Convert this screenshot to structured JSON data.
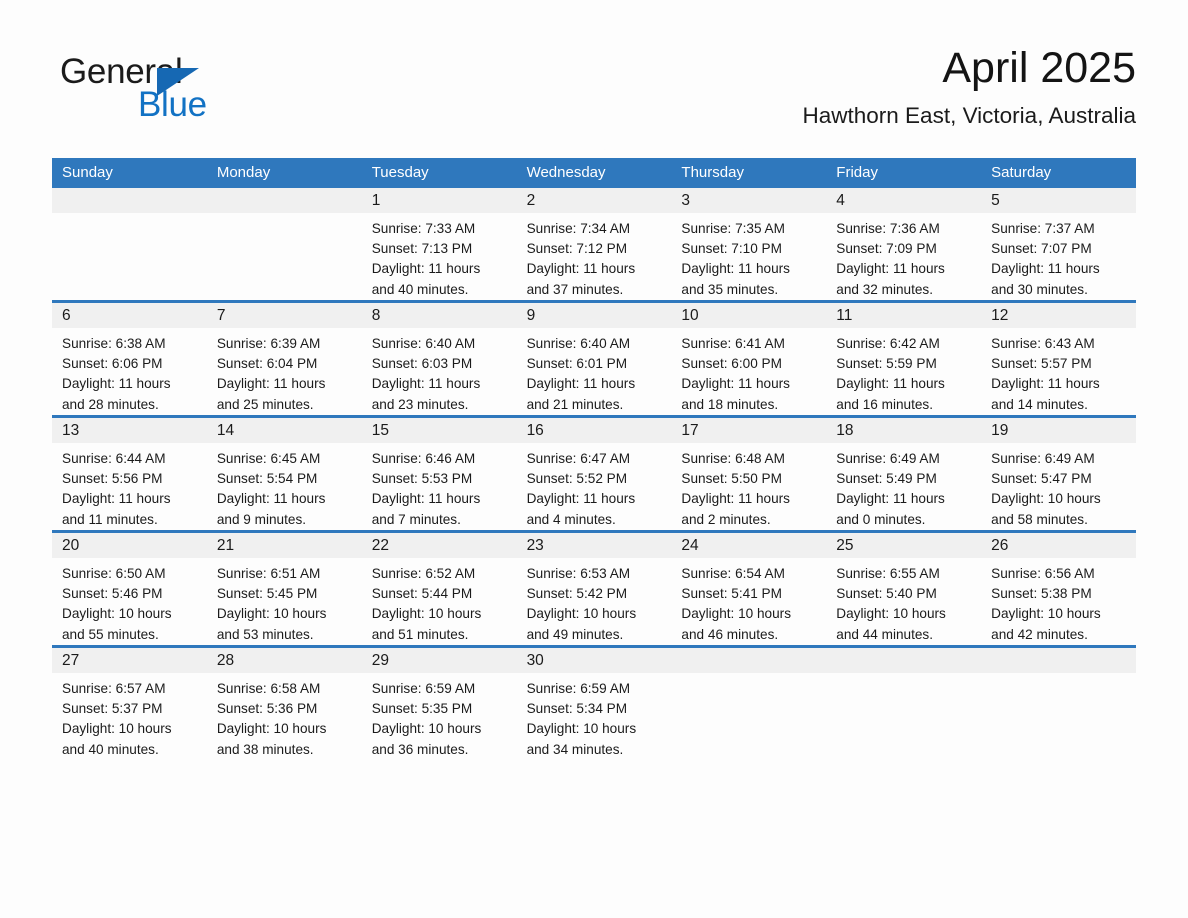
{
  "logo": {
    "word_one": "General",
    "word_two": "Blue",
    "triangle_color": "#1668b3",
    "blue_color": "#1272c4"
  },
  "header": {
    "month_title": "April 2025",
    "location": "Hawthorn East, Victoria, Australia"
  },
  "theme": {
    "header_blue": "#2f78bd",
    "day_band_gray": "#f0f0f0",
    "page_background": "#fdfdfd",
    "text_color": "#1b1b1b"
  },
  "weekdays": [
    "Sunday",
    "Monday",
    "Tuesday",
    "Wednesday",
    "Thursday",
    "Friday",
    "Saturday"
  ],
  "weeks": [
    [
      {
        "day": "",
        "empty": true,
        "sunrise": "",
        "sunset": "",
        "daylight_line1": "",
        "daylight_line2": ""
      },
      {
        "day": "",
        "empty": true,
        "sunrise": "",
        "sunset": "",
        "daylight_line1": "",
        "daylight_line2": ""
      },
      {
        "day": "1",
        "empty": false,
        "sunrise": "Sunrise: 7:33 AM",
        "sunset": "Sunset: 7:13 PM",
        "daylight_line1": "Daylight: 11 hours",
        "daylight_line2": "and 40 minutes."
      },
      {
        "day": "2",
        "empty": false,
        "sunrise": "Sunrise: 7:34 AM",
        "sunset": "Sunset: 7:12 PM",
        "daylight_line1": "Daylight: 11 hours",
        "daylight_line2": "and 37 minutes."
      },
      {
        "day": "3",
        "empty": false,
        "sunrise": "Sunrise: 7:35 AM",
        "sunset": "Sunset: 7:10 PM",
        "daylight_line1": "Daylight: 11 hours",
        "daylight_line2": "and 35 minutes."
      },
      {
        "day": "4",
        "empty": false,
        "sunrise": "Sunrise: 7:36 AM",
        "sunset": "Sunset: 7:09 PM",
        "daylight_line1": "Daylight: 11 hours",
        "daylight_line2": "and 32 minutes."
      },
      {
        "day": "5",
        "empty": false,
        "sunrise": "Sunrise: 7:37 AM",
        "sunset": "Sunset: 7:07 PM",
        "daylight_line1": "Daylight: 11 hours",
        "daylight_line2": "and 30 minutes."
      }
    ],
    [
      {
        "day": "6",
        "empty": false,
        "sunrise": "Sunrise: 6:38 AM",
        "sunset": "Sunset: 6:06 PM",
        "daylight_line1": "Daylight: 11 hours",
        "daylight_line2": "and 28 minutes."
      },
      {
        "day": "7",
        "empty": false,
        "sunrise": "Sunrise: 6:39 AM",
        "sunset": "Sunset: 6:04 PM",
        "daylight_line1": "Daylight: 11 hours",
        "daylight_line2": "and 25 minutes."
      },
      {
        "day": "8",
        "empty": false,
        "sunrise": "Sunrise: 6:40 AM",
        "sunset": "Sunset: 6:03 PM",
        "daylight_line1": "Daylight: 11 hours",
        "daylight_line2": "and 23 minutes."
      },
      {
        "day": "9",
        "empty": false,
        "sunrise": "Sunrise: 6:40 AM",
        "sunset": "Sunset: 6:01 PM",
        "daylight_line1": "Daylight: 11 hours",
        "daylight_line2": "and 21 minutes."
      },
      {
        "day": "10",
        "empty": false,
        "sunrise": "Sunrise: 6:41 AM",
        "sunset": "Sunset: 6:00 PM",
        "daylight_line1": "Daylight: 11 hours",
        "daylight_line2": "and 18 minutes."
      },
      {
        "day": "11",
        "empty": false,
        "sunrise": "Sunrise: 6:42 AM",
        "sunset": "Sunset: 5:59 PM",
        "daylight_line1": "Daylight: 11 hours",
        "daylight_line2": "and 16 minutes."
      },
      {
        "day": "12",
        "empty": false,
        "sunrise": "Sunrise: 6:43 AM",
        "sunset": "Sunset: 5:57 PM",
        "daylight_line1": "Daylight: 11 hours",
        "daylight_line2": "and 14 minutes."
      }
    ],
    [
      {
        "day": "13",
        "empty": false,
        "sunrise": "Sunrise: 6:44 AM",
        "sunset": "Sunset: 5:56 PM",
        "daylight_line1": "Daylight: 11 hours",
        "daylight_line2": "and 11 minutes."
      },
      {
        "day": "14",
        "empty": false,
        "sunrise": "Sunrise: 6:45 AM",
        "sunset": "Sunset: 5:54 PM",
        "daylight_line1": "Daylight: 11 hours",
        "daylight_line2": "and 9 minutes."
      },
      {
        "day": "15",
        "empty": false,
        "sunrise": "Sunrise: 6:46 AM",
        "sunset": "Sunset: 5:53 PM",
        "daylight_line1": "Daylight: 11 hours",
        "daylight_line2": "and 7 minutes."
      },
      {
        "day": "16",
        "empty": false,
        "sunrise": "Sunrise: 6:47 AM",
        "sunset": "Sunset: 5:52 PM",
        "daylight_line1": "Daylight: 11 hours",
        "daylight_line2": "and 4 minutes."
      },
      {
        "day": "17",
        "empty": false,
        "sunrise": "Sunrise: 6:48 AM",
        "sunset": "Sunset: 5:50 PM",
        "daylight_line1": "Daylight: 11 hours",
        "daylight_line2": "and 2 minutes."
      },
      {
        "day": "18",
        "empty": false,
        "sunrise": "Sunrise: 6:49 AM",
        "sunset": "Sunset: 5:49 PM",
        "daylight_line1": "Daylight: 11 hours",
        "daylight_line2": "and 0 minutes."
      },
      {
        "day": "19",
        "empty": false,
        "sunrise": "Sunrise: 6:49 AM",
        "sunset": "Sunset: 5:47 PM",
        "daylight_line1": "Daylight: 10 hours",
        "daylight_line2": "and 58 minutes."
      }
    ],
    [
      {
        "day": "20",
        "empty": false,
        "sunrise": "Sunrise: 6:50 AM",
        "sunset": "Sunset: 5:46 PM",
        "daylight_line1": "Daylight: 10 hours",
        "daylight_line2": "and 55 minutes."
      },
      {
        "day": "21",
        "empty": false,
        "sunrise": "Sunrise: 6:51 AM",
        "sunset": "Sunset: 5:45 PM",
        "daylight_line1": "Daylight: 10 hours",
        "daylight_line2": "and 53 minutes."
      },
      {
        "day": "22",
        "empty": false,
        "sunrise": "Sunrise: 6:52 AM",
        "sunset": "Sunset: 5:44 PM",
        "daylight_line1": "Daylight: 10 hours",
        "daylight_line2": "and 51 minutes."
      },
      {
        "day": "23",
        "empty": false,
        "sunrise": "Sunrise: 6:53 AM",
        "sunset": "Sunset: 5:42 PM",
        "daylight_line1": "Daylight: 10 hours",
        "daylight_line2": "and 49 minutes."
      },
      {
        "day": "24",
        "empty": false,
        "sunrise": "Sunrise: 6:54 AM",
        "sunset": "Sunset: 5:41 PM",
        "daylight_line1": "Daylight: 10 hours",
        "daylight_line2": "and 46 minutes."
      },
      {
        "day": "25",
        "empty": false,
        "sunrise": "Sunrise: 6:55 AM",
        "sunset": "Sunset: 5:40 PM",
        "daylight_line1": "Daylight: 10 hours",
        "daylight_line2": "and 44 minutes."
      },
      {
        "day": "26",
        "empty": false,
        "sunrise": "Sunrise: 6:56 AM",
        "sunset": "Sunset: 5:38 PM",
        "daylight_line1": "Daylight: 10 hours",
        "daylight_line2": "and 42 minutes."
      }
    ],
    [
      {
        "day": "27",
        "empty": false,
        "sunrise": "Sunrise: 6:57 AM",
        "sunset": "Sunset: 5:37 PM",
        "daylight_line1": "Daylight: 10 hours",
        "daylight_line2": "and 40 minutes."
      },
      {
        "day": "28",
        "empty": false,
        "sunrise": "Sunrise: 6:58 AM",
        "sunset": "Sunset: 5:36 PM",
        "daylight_line1": "Daylight: 10 hours",
        "daylight_line2": "and 38 minutes."
      },
      {
        "day": "29",
        "empty": false,
        "sunrise": "Sunrise: 6:59 AM",
        "sunset": "Sunset: 5:35 PM",
        "daylight_line1": "Daylight: 10 hours",
        "daylight_line2": "and 36 minutes."
      },
      {
        "day": "30",
        "empty": false,
        "sunrise": "Sunrise: 6:59 AM",
        "sunset": "Sunset: 5:34 PM",
        "daylight_line1": "Daylight: 10 hours",
        "daylight_line2": "and 34 minutes."
      },
      {
        "day": "",
        "empty": true,
        "sunrise": "",
        "sunset": "",
        "daylight_line1": "",
        "daylight_line2": ""
      },
      {
        "day": "",
        "empty": true,
        "sunrise": "",
        "sunset": "",
        "daylight_line1": "",
        "daylight_line2": ""
      },
      {
        "day": "",
        "empty": true,
        "sunrise": "",
        "sunset": "",
        "daylight_line1": "",
        "daylight_line2": ""
      }
    ]
  ]
}
